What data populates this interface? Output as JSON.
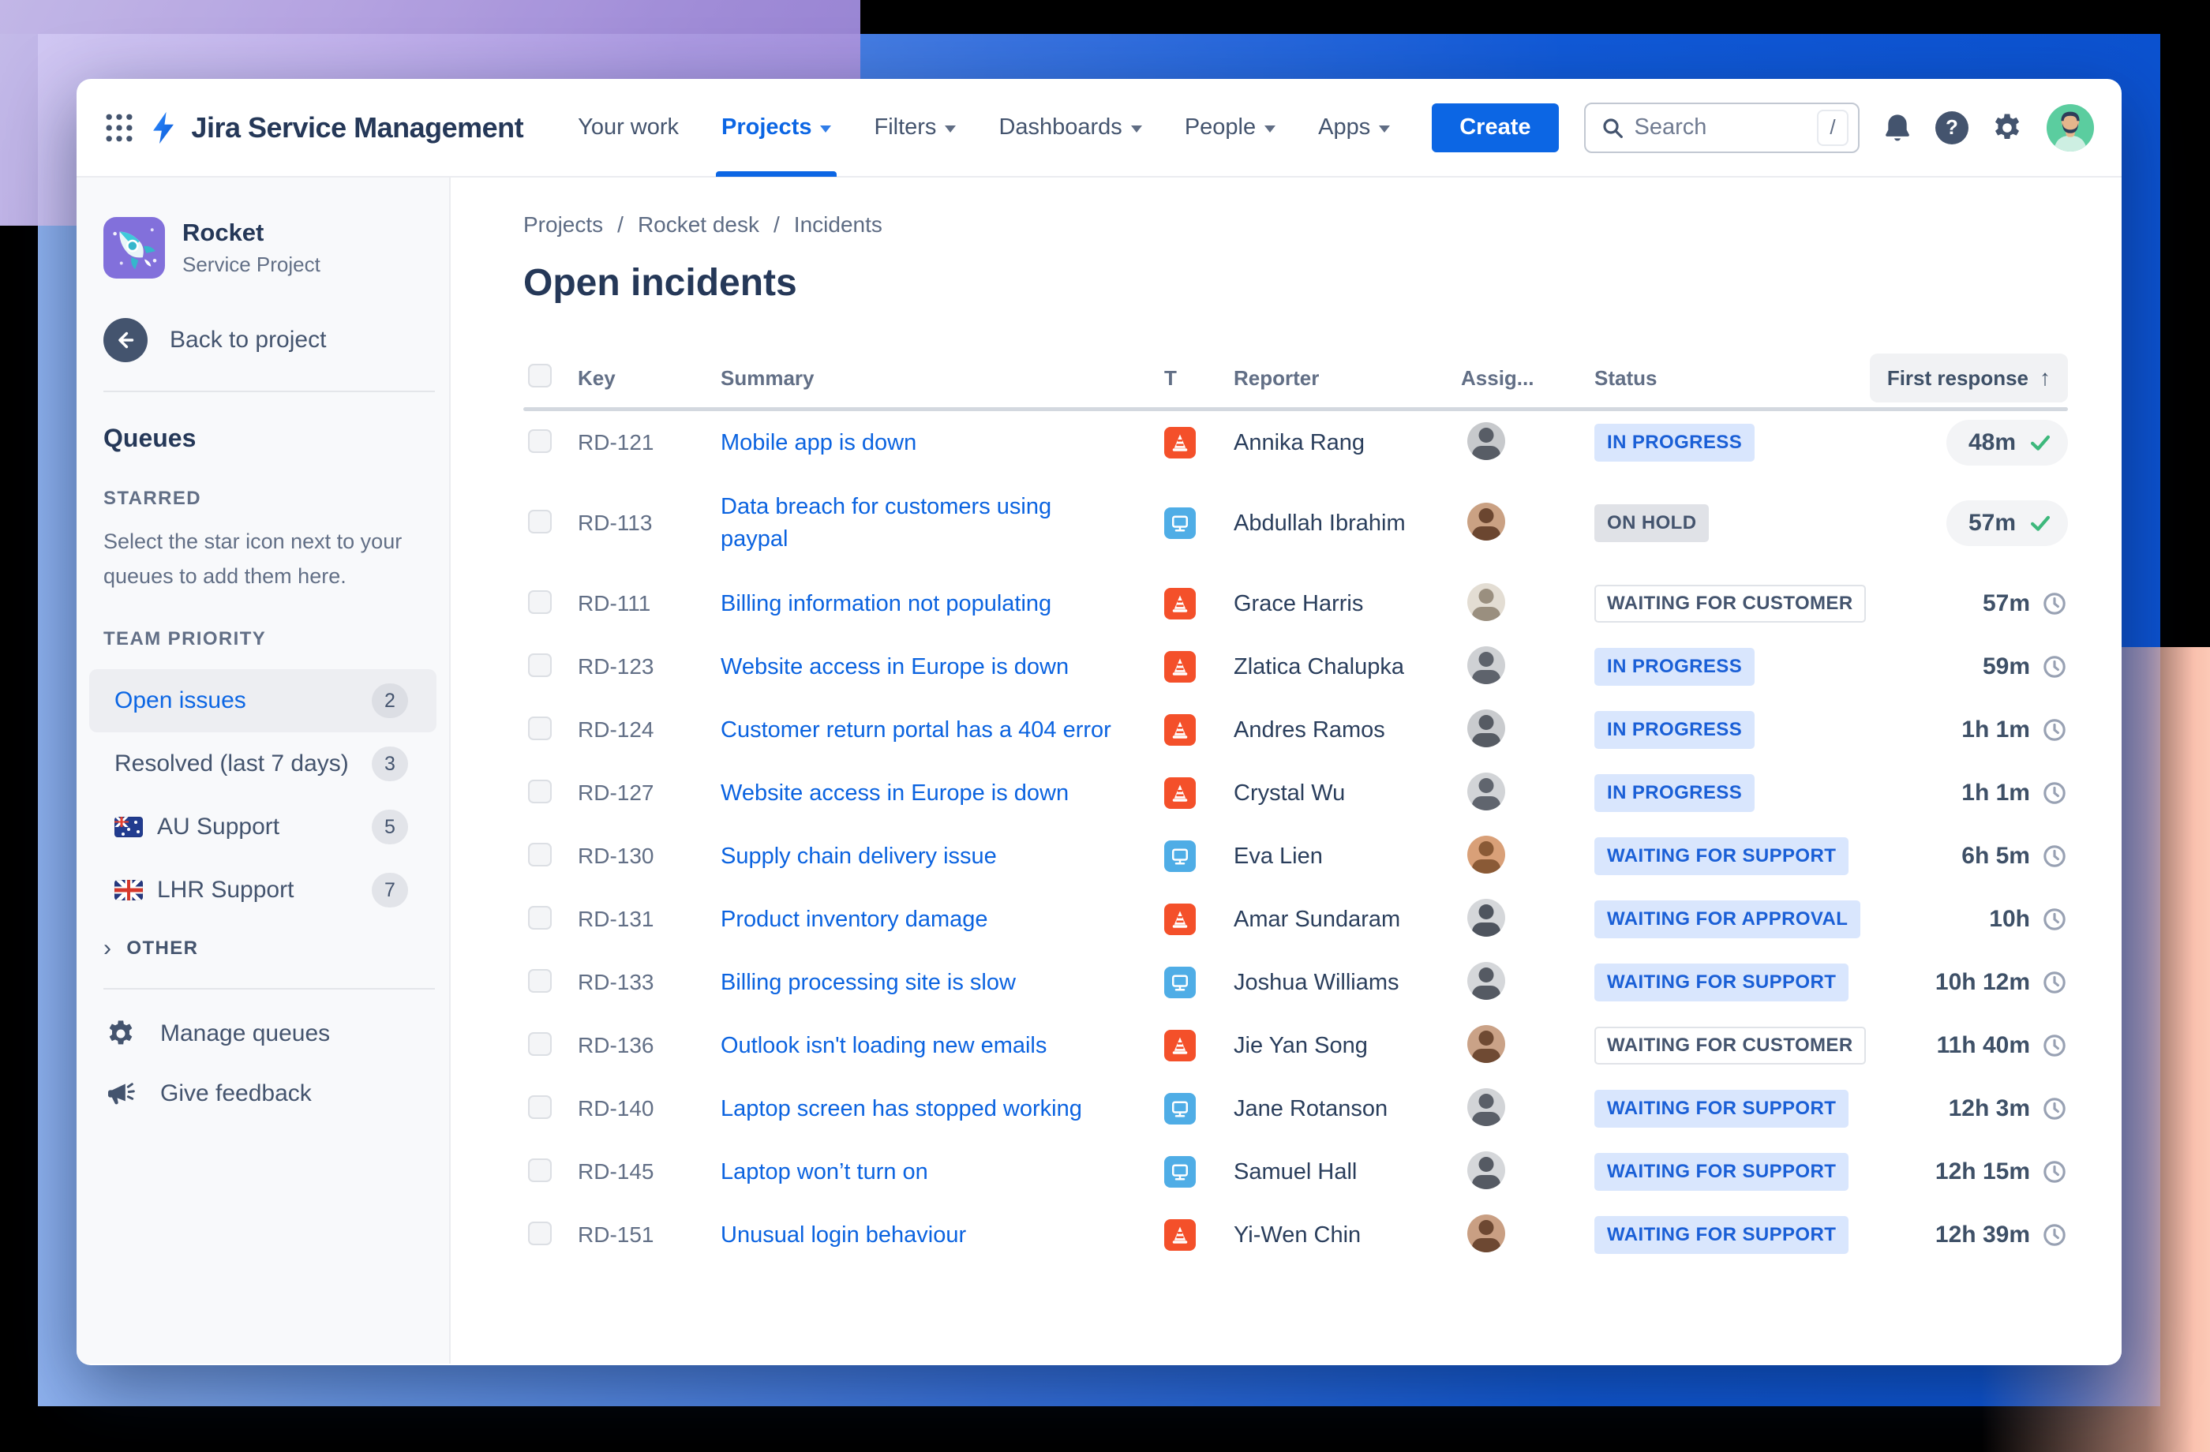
{
  "colors": {
    "accent_blue": "#0C66E4",
    "band_blue": "#0D53D2",
    "backdrop_purple": "#A99BDF",
    "backdrop_salmon": "#FBC0AC",
    "incident_orange": "#F4502A",
    "request_blue": "#4FADE6",
    "success_green": "#3DB87C"
  },
  "nav": {
    "app_name": "Jira Service Management",
    "items": [
      {
        "label": "Your work"
      },
      {
        "label": "Projects",
        "active": true
      },
      {
        "label": "Filters"
      },
      {
        "label": "Dashboards"
      },
      {
        "label": "People"
      },
      {
        "label": "Apps"
      }
    ],
    "create_label": "Create",
    "search_placeholder": "Search",
    "search_shortcut": "/",
    "help_glyph": "?"
  },
  "sidebar": {
    "project_name": "Rocket",
    "project_type": "Service Project",
    "back_label": "Back to project",
    "queues_heading": "Queues",
    "starred_heading": "STARRED",
    "starred_hint": "Select the star icon next to your queues to add them here.",
    "team_heading": "TEAM PRIORITY",
    "items": [
      {
        "label": "Open issues",
        "count": "2",
        "active": true
      },
      {
        "label": "Resolved (last 7 days)",
        "count": "3"
      },
      {
        "label": "AU Support",
        "count": "5",
        "flag": "au"
      },
      {
        "label": "LHR Support",
        "count": "7",
        "flag": "gb"
      }
    ],
    "other_heading": "OTHER",
    "manage_label": "Manage queues",
    "feedback_label": "Give feedback"
  },
  "main": {
    "breadcrumb": [
      "Projects",
      "Rocket desk",
      "Incidents"
    ],
    "breadcrumb_separator": "/",
    "title": "Open incidents",
    "table": {
      "headers": {
        "key": "Key",
        "summary": "Summary",
        "type": "T",
        "reporter": "Reporter",
        "assignee": "Assig...",
        "status": "Status",
        "first_response": "First response"
      },
      "sort_indicator": "↑",
      "rows": [
        {
          "key": "RD-121",
          "summary": "Mobile app is down",
          "type": "incident",
          "reporter": "Annika Rang",
          "status": "IN PROGRESS",
          "status_type": "inprogress",
          "first_response": "48m",
          "response_state": "met",
          "avatar": {
            "bg": "#c7c9cc",
            "fg": "#585d66"
          }
        },
        {
          "key": "RD-113",
          "summary": "Data breach for customers using paypal",
          "tall": true,
          "type": "request",
          "reporter": "Abdullah Ibrahim",
          "status": "ON HOLD",
          "status_type": "onhold",
          "first_response": "57m",
          "response_state": "met",
          "avatar": {
            "bg": "#caa183",
            "fg": "#6b4630"
          }
        },
        {
          "key": "RD-111",
          "summary": "Billing information not populating",
          "type": "incident",
          "reporter": "Grace Harris",
          "status": "WAITING FOR CUSTOMER",
          "status_type": "customer",
          "first_response": "57m",
          "response_state": "pending",
          "avatar": {
            "bg": "#e3ddd3",
            "fg": "#9a8f7f"
          }
        },
        {
          "key": "RD-123",
          "summary": "Website access in Europe is down",
          "type": "incident",
          "reporter": "Zlatica Chalupka",
          "status": "IN PROGRESS",
          "status_type": "inprogress",
          "first_response": "59m",
          "response_state": "pending",
          "avatar": {
            "bg": "#cfd1d4",
            "fg": "#5e636c"
          }
        },
        {
          "key": "RD-124",
          "summary": "Customer return portal has a 404 error",
          "type": "incident",
          "reporter": "Andres Ramos",
          "status": "IN PROGRESS",
          "status_type": "inprogress",
          "first_response": "1h 1m",
          "response_state": "pending",
          "avatar": {
            "bg": "#c9cbce",
            "fg": "#565b63"
          }
        },
        {
          "key": "RD-127",
          "summary": "Website access in Europe is down",
          "type": "incident",
          "reporter": "Crystal Wu",
          "status": "IN PROGRESS",
          "status_type": "inprogress",
          "first_response": "1h 1m",
          "response_state": "pending",
          "avatar": {
            "bg": "#d2d4d7",
            "fg": "#60656e"
          }
        },
        {
          "key": "RD-130",
          "summary": "Supply chain delivery issue",
          "type": "request",
          "reporter": "Eva Lien",
          "status": "WAITING FOR SUPPORT",
          "status_type": "support",
          "first_response": "6h 5m",
          "response_state": "pending",
          "avatar": {
            "bg": "#d9a078",
            "fg": "#8a5a36"
          }
        },
        {
          "key": "RD-131",
          "summary": "Product inventory damage",
          "type": "incident",
          "reporter": "Amar Sundaram",
          "status": "WAITING FOR APPROVAL",
          "status_type": "approval",
          "first_response": "10h",
          "response_state": "pending",
          "avatar": {
            "bg": "#d5d7da",
            "fg": "#4e545e"
          }
        },
        {
          "key": "RD-133",
          "summary": "Billing processing site is slow",
          "type": "request",
          "reporter": "Joshua Williams",
          "status": "WAITING FOR SUPPORT",
          "status_type": "support",
          "first_response": "10h 12m",
          "response_state": "pending",
          "avatar": {
            "bg": "#d5d7da",
            "fg": "#555a63"
          }
        },
        {
          "key": "RD-136",
          "summary": "Outlook isn't loading new emails",
          "type": "incident",
          "reporter": "Jie Yan Song",
          "status": "WAITING FOR CUSTOMER",
          "status_type": "customer",
          "first_response": "11h 40m",
          "response_state": "pending",
          "avatar": {
            "bg": "#caa287",
            "fg": "#6f4a33"
          }
        },
        {
          "key": "RD-140",
          "summary": "Laptop screen has stopped working",
          "type": "request",
          "reporter": "Jane Rotanson",
          "status": "WAITING FOR SUPPORT",
          "status_type": "support",
          "first_response": "12h 3m",
          "response_state": "pending",
          "avatar": {
            "bg": "#d2d4d7",
            "fg": "#5a5f68"
          }
        },
        {
          "key": "RD-145",
          "summary": "Laptop won’t turn on",
          "type": "request",
          "reporter": "Samuel Hall",
          "status": "WAITING FOR SUPPORT",
          "status_type": "support",
          "first_response": "12h 15m",
          "response_state": "pending",
          "avatar": {
            "bg": "#d5d7da",
            "fg": "#555a63"
          }
        },
        {
          "key": "RD-151",
          "summary": "Unusual login behaviour",
          "type": "incident",
          "reporter": "Yi-Wen Chin",
          "status": "WAITING FOR SUPPORT",
          "status_type": "support",
          "first_response": "12h 39m",
          "response_state": "pending",
          "avatar": {
            "bg": "#c99f83",
            "fg": "#6d4832"
          }
        }
      ]
    }
  }
}
